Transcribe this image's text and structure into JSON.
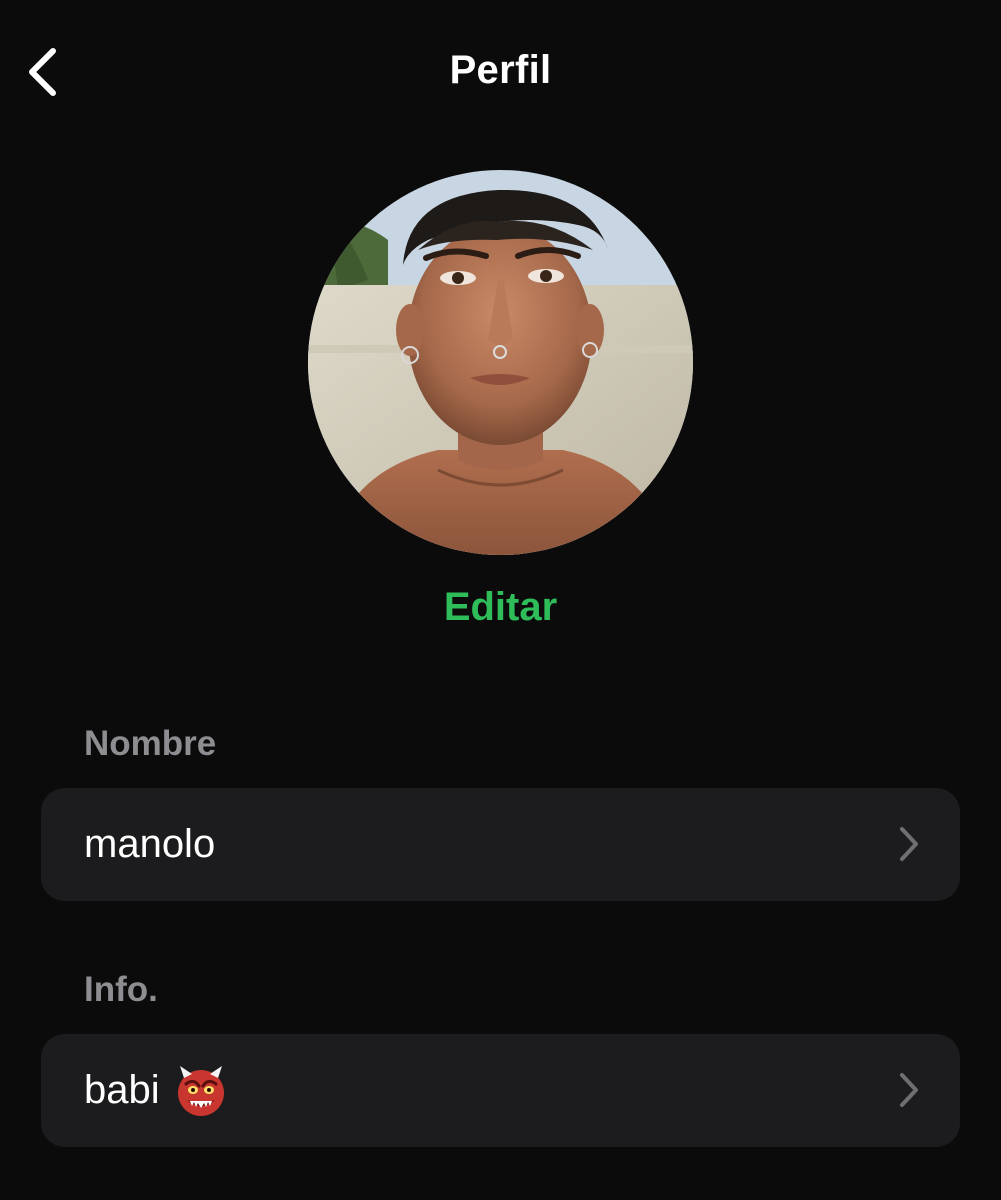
{
  "header": {
    "title": "Perfil",
    "back_icon": "chevron-left-icon"
  },
  "profile": {
    "avatar": "profile-photo",
    "edit_label": "Editar"
  },
  "sections": {
    "name": {
      "label": "Nombre",
      "value": "manolo",
      "chevron_icon": "chevron-right-icon"
    },
    "info": {
      "label": "Info.",
      "value": "babi",
      "emoji": "ogre-emoji",
      "chevron_icon": "chevron-right-icon"
    }
  },
  "colors": {
    "background": "#0b0b0c",
    "row_background": "#1c1c1e",
    "accent": "#2fbd5a",
    "section_label": "#8d8d92",
    "chevron": "#6e6e73"
  }
}
